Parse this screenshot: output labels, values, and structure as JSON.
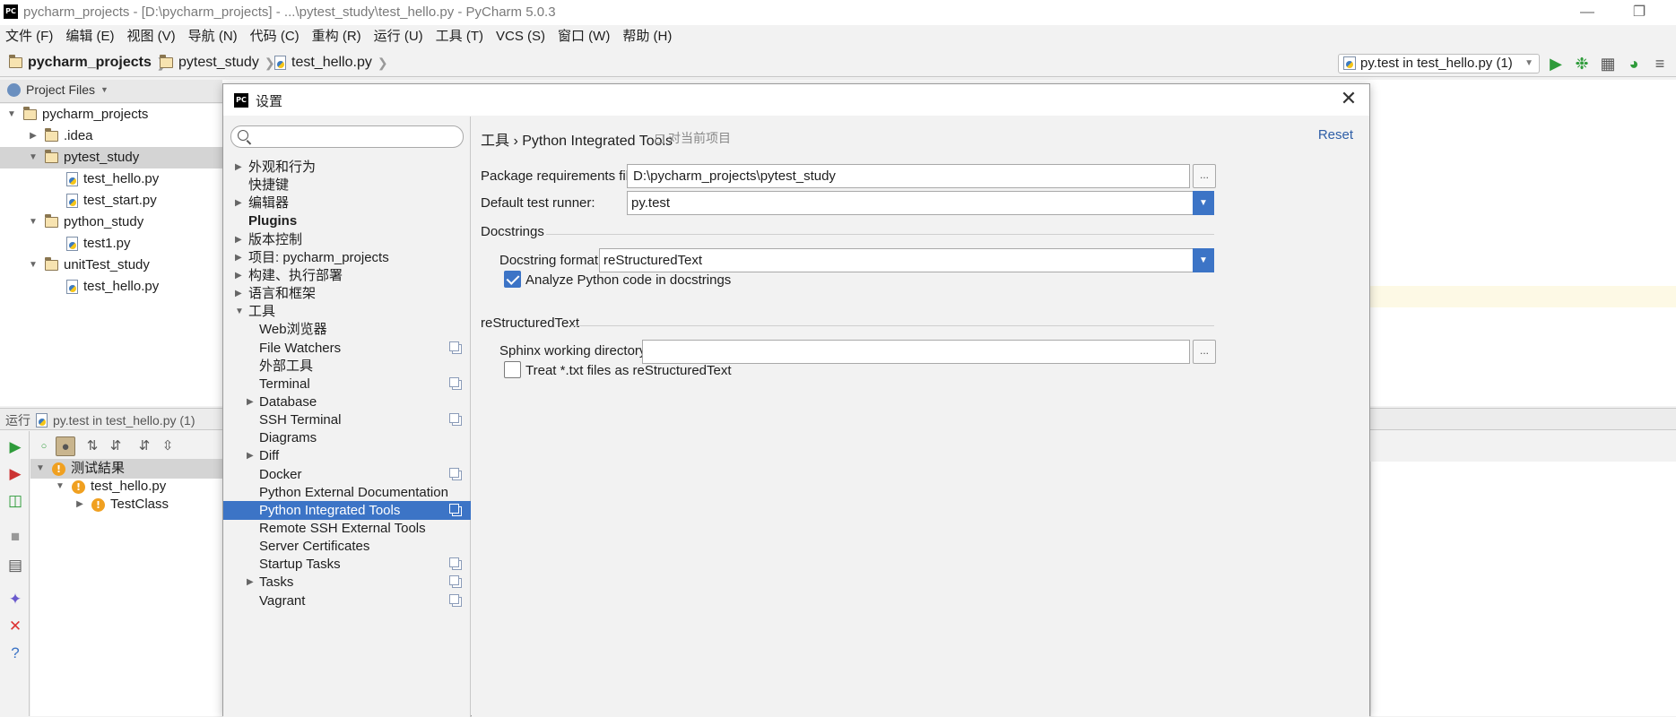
{
  "window": {
    "title": "pycharm_projects - [D:\\pycharm_projects] - ...\\pytest_study\\test_hello.py - PyCharm 5.0.3",
    "logo": "PC"
  },
  "menu": [
    "文件 (F)",
    "编辑 (E)",
    "视图 (V)",
    "导航 (N)",
    "代码 (C)",
    "重构 (R)",
    "运行 (U)",
    "工具 (T)",
    "VCS (S)",
    "窗口 (W)",
    "帮助 (H)"
  ],
  "navbar": {
    "crumbs": [
      "pycharm_projects",
      "pytest_study",
      "test_hello.py"
    ],
    "run_config": "py.test in test_hello.py (1)"
  },
  "project_panel": {
    "header": "Project Files",
    "tree": [
      {
        "label": "pycharm_projects",
        "type": "folder",
        "level": 0,
        "arrow": "▼"
      },
      {
        "label": ".idea",
        "type": "folder",
        "level": 1,
        "arrow": "▶"
      },
      {
        "label": "pytest_study",
        "type": "folder",
        "level": 1,
        "arrow": "▼"
      },
      {
        "label": "test_hello.py",
        "type": "py",
        "level": 2,
        "arrow": ""
      },
      {
        "label": "test_start.py",
        "type": "py",
        "level": 2,
        "arrow": ""
      },
      {
        "label": "python_study",
        "type": "folder",
        "level": 1,
        "arrow": "▼"
      },
      {
        "label": "test1.py",
        "type": "py",
        "level": 2,
        "arrow": ""
      },
      {
        "label": "unitTest_study",
        "type": "folder",
        "level": 1,
        "arrow": "▼"
      },
      {
        "label": "test_hello.py",
        "type": "py",
        "level": 2,
        "arrow": ""
      }
    ]
  },
  "run_panel": {
    "header_prefix": "运行",
    "header_config": "py.test in test_hello.py (1)",
    "tree": [
      {
        "label": "测试結果",
        "arrow": "▼"
      },
      {
        "label": "test_hello.py",
        "arrow": "▼"
      },
      {
        "label": "TestClass",
        "arrow": "▶"
      }
    ]
  },
  "dialog": {
    "title": "设置",
    "logo": "PC",
    "close": "✕",
    "nav": [
      {
        "label": "外观和行为",
        "arrow": "▶",
        "indent": 1,
        "bold": false,
        "copy": false
      },
      {
        "label": "快捷键",
        "arrow": "",
        "indent": 1,
        "bold": false,
        "copy": false
      },
      {
        "label": "编辑器",
        "arrow": "▶",
        "indent": 1,
        "bold": false,
        "copy": false
      },
      {
        "label": "Plugins",
        "arrow": "",
        "indent": 1,
        "bold": true,
        "copy": false
      },
      {
        "label": "版本控制",
        "arrow": "▶",
        "indent": 1,
        "bold": false,
        "copy": false
      },
      {
        "label": "项目: pycharm_projects",
        "arrow": "▶",
        "indent": 1,
        "bold": false,
        "copy": false
      },
      {
        "label": "构建、执行部署",
        "arrow": "▶",
        "indent": 1,
        "bold": false,
        "copy": false
      },
      {
        "label": "语言和框架",
        "arrow": "▶",
        "indent": 1,
        "bold": false,
        "copy": false
      },
      {
        "label": "工具",
        "arrow": "▼",
        "indent": 1,
        "bold": false,
        "copy": false
      },
      {
        "label": "Web浏览器",
        "arrow": "",
        "indent": 2,
        "bold": false,
        "copy": false
      },
      {
        "label": "File Watchers",
        "arrow": "",
        "indent": 2,
        "bold": false,
        "copy": true
      },
      {
        "label": "外部工具",
        "arrow": "",
        "indent": 2,
        "bold": false,
        "copy": false
      },
      {
        "label": "Terminal",
        "arrow": "",
        "indent": 2,
        "bold": false,
        "copy": true
      },
      {
        "label": "Database",
        "arrow": "▶",
        "indent": 2,
        "bold": false,
        "copy": false
      },
      {
        "label": "SSH Terminal",
        "arrow": "",
        "indent": 2,
        "bold": false,
        "copy": true
      },
      {
        "label": "Diagrams",
        "arrow": "",
        "indent": 2,
        "bold": false,
        "copy": false
      },
      {
        "label": "Diff",
        "arrow": "▶",
        "indent": 2,
        "bold": false,
        "copy": false
      },
      {
        "label": "Docker",
        "arrow": "",
        "indent": 2,
        "bold": false,
        "copy": true
      },
      {
        "label": "Python External Documentation",
        "arrow": "",
        "indent": 2,
        "bold": false,
        "copy": false
      },
      {
        "label": "Python Integrated Tools",
        "arrow": "",
        "indent": 2,
        "bold": false,
        "copy": true,
        "selected": true
      },
      {
        "label": "Remote SSH External Tools",
        "arrow": "",
        "indent": 2,
        "bold": false,
        "copy": false
      },
      {
        "label": "Server Certificates",
        "arrow": "",
        "indent": 2,
        "bold": false,
        "copy": false
      },
      {
        "label": "Startup Tasks",
        "arrow": "",
        "indent": 2,
        "bold": false,
        "copy": true
      },
      {
        "label": "Tasks",
        "arrow": "▶",
        "indent": 2,
        "bold": false,
        "copy": true
      },
      {
        "label": "Vagrant",
        "arrow": "",
        "indent": 2,
        "bold": false,
        "copy": true
      }
    ],
    "content": {
      "breadcrumb": "工具 › Python Integrated Tools",
      "scope": "对当前项目",
      "reset": "Reset",
      "package_requirements_label": "Package requirements file:",
      "package_requirements_value": "D:\\pycharm_projects\\pytest_study",
      "default_runner_label": "Default test runner:",
      "default_runner_value": "py.test",
      "docstrings_group": "Docstrings",
      "docstring_format_label": "Docstring format:",
      "docstring_format_value": "reStructuredText",
      "analyze_label": "Analyze Python code in docstrings",
      "analyze_checked": true,
      "rst_group": "reStructuredText",
      "sphinx_label": "Sphinx working directory:",
      "sphinx_value": "",
      "treat_txt_label": "Treat *.txt files as reStructuredText",
      "treat_txt_checked": false,
      "browse": "..."
    }
  }
}
